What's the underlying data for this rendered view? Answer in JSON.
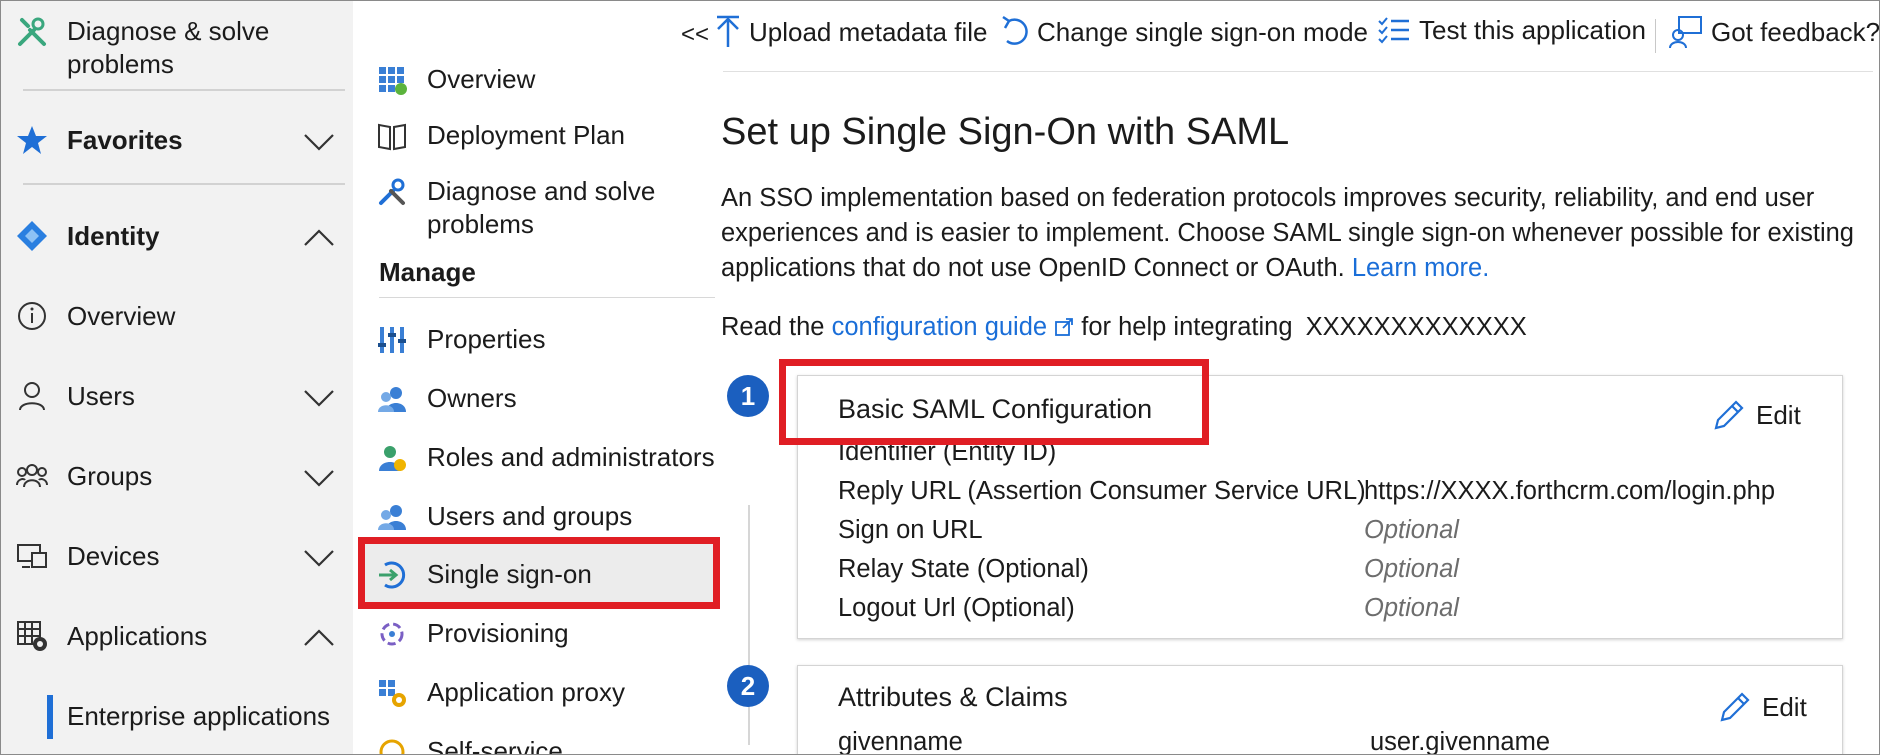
{
  "left_nav": {
    "diagnose_line1": "Diagnose & solve",
    "diagnose_line2": "problems",
    "favorites": "Favorites",
    "identity": "Identity",
    "overview": "Overview",
    "users": "Users",
    "groups": "Groups",
    "devices": "Devices",
    "applications": "Applications",
    "enterprise_applications": "Enterprise applications"
  },
  "mid_nav": {
    "overview": "Overview",
    "deployment_plan": "Deployment Plan",
    "diagnose_line1": "Diagnose and solve",
    "diagnose_line2": "problems",
    "manage_heading": "Manage",
    "properties": "Properties",
    "owners": "Owners",
    "roles_admins": "Roles and administrators",
    "users_groups": "Users and groups",
    "single_sign_on": "Single sign-on",
    "provisioning": "Provisioning",
    "application_proxy": "Application proxy",
    "self_service": "Self-service"
  },
  "toolbar": {
    "collapse": "<<",
    "upload_metadata": "Upload metadata file",
    "change_sso_mode": "Change single sign-on mode",
    "test_application": "Test this application",
    "feedback": "Got feedback?"
  },
  "main": {
    "title": "Set up Single Sign-On with SAML",
    "description": "An SSO implementation based on federation protocols improves security, reliability, and end user experiences and is easier to implement. Choose SAML single sign-on whenever possible for existing applications that do not use OpenID Connect or OAuth.",
    "learn_more": "Learn more.",
    "read_prefix": "Read the",
    "config_guide": "configuration guide",
    "read_suffix": "for help integrating",
    "app_name": "XXXXXXXXXXXXX"
  },
  "card1": {
    "step": "1",
    "title": "Basic SAML Configuration",
    "edit": "Edit",
    "rows": [
      {
        "label": "Identifier (Entity ID)",
        "value": ""
      },
      {
        "label": "Reply URL (Assertion Consumer Service URL)",
        "value": "https://XXXX.forthcrm.com/login.php"
      },
      {
        "label": "Sign on URL",
        "value": "Optional"
      },
      {
        "label": "Relay State (Optional)",
        "value": "Optional"
      },
      {
        "label": "Logout Url (Optional)",
        "value": "Optional"
      }
    ]
  },
  "card2": {
    "step": "2",
    "title": "Attributes & Claims",
    "edit": "Edit",
    "rows": [
      {
        "label": "givenname",
        "value": "user.givenname"
      }
    ]
  },
  "colors": {
    "accent_blue": "#1a6ed8",
    "badge_blue": "#1b5fbf",
    "highlight_red": "#e01e24",
    "sidebar_bg": "#f2f2f2"
  }
}
